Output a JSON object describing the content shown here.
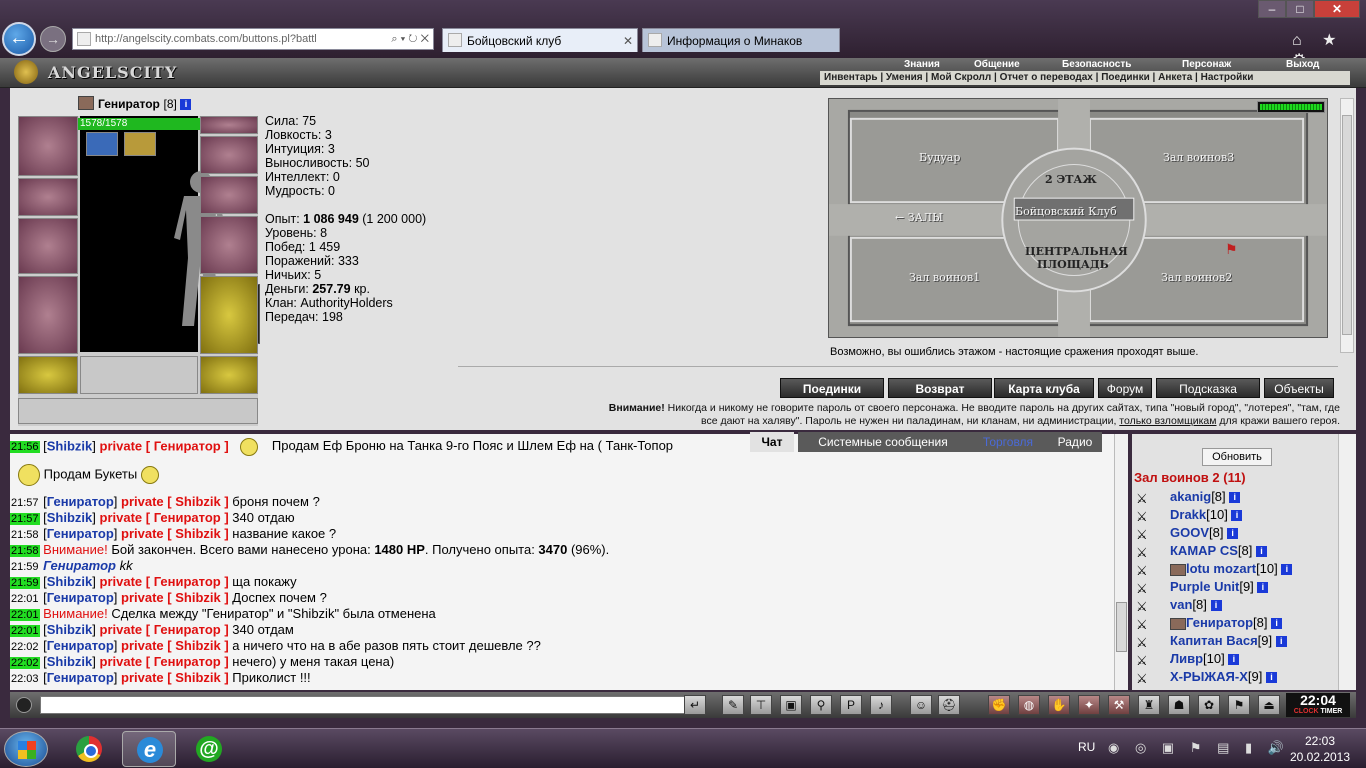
{
  "browser": {
    "address": "http://angelscity.combats.com/buttons.pl?battl",
    "tabs": [
      {
        "label": "Бойцовский клуб"
      },
      {
        "label": "Информация о Минаков"
      }
    ],
    "window_buttons": {
      "minimize": "–",
      "maximize": "□",
      "close": "✕"
    },
    "right_icons": "⌂ ★ ⚙"
  },
  "game": {
    "logo": "ANGELSCITY",
    "top_menu": [
      "Знания",
      "Общение",
      "Безопасность",
      "Персонаж",
      "Выход"
    ],
    "sub_menu": [
      "Инвентарь",
      "Умения",
      "Мой Скролл",
      "Отчет о переводах",
      "Поединки",
      "Анкета",
      "Настройки"
    ]
  },
  "character": {
    "name": "Гениратор",
    "level": "[8]",
    "hp": "1578/1578",
    "stats": [
      {
        "label": "Сила:",
        "value": "75"
      },
      {
        "label": "Ловкость:",
        "value": "3"
      },
      {
        "label": "Интуиция:",
        "value": "3"
      },
      {
        "label": "Выносливость:",
        "value": "50"
      },
      {
        "label": "Интеллект:",
        "value": "0"
      },
      {
        "label": "Мудрость:",
        "value": "0"
      }
    ],
    "exp_label": "Опыт:",
    "exp_value": "1 086 949",
    "exp_next": "(1 200 000)",
    "info": [
      {
        "label": "Уровень:",
        "value": "8"
      },
      {
        "label": "Побед:",
        "value": "1 459"
      },
      {
        "label": "Поражений:",
        "value": "333"
      },
      {
        "label": "Ничьих:",
        "value": "5"
      }
    ],
    "money_label": "Деньги:",
    "money_value": "257.79",
    "money_unit": "кр.",
    "clan_label": "Клан:",
    "clan_value": "AuthorityHolders",
    "transfers_label": "Передач:",
    "transfers_value": "198"
  },
  "map": {
    "labels": {
      "boudoir": "Будуар",
      "hall3": "Зал воинов3",
      "floor": "2 ЭТАЖ",
      "club": "Бойцовский Клуб",
      "halls": "← ЗАЛЫ",
      "central": "ЦЕНТРАЛЬНАЯ",
      "square": "ПЛОЩАДЬ",
      "hall1": "Зал воинов1",
      "hall2": "Зал воинов2"
    },
    "note": "Возможно, вы ошиблись этажом - настоящие сражения проходят выше."
  },
  "nav_buttons": [
    "Поединки",
    "Возврат",
    "Карта клуба",
    "Форум",
    "Подсказка",
    "Объекты"
  ],
  "warning": {
    "bold": "Внимание!",
    "text1": " Никогда и никому не говорите пароль от своего персонажа. Не вводите пароль на других сайтах, типа \"новый город\", \"лотерея\", \"там, где",
    "text2": "все дают на халяву\". Пароль не нужен ни паладинам, ни кланам, ни администрации, ",
    "link": "только взломщикам",
    "text3": " для кражи вашего героя."
  },
  "chat_tabs": [
    "Чат",
    "Системные сообщения",
    "Торговля",
    "Радио"
  ],
  "chat": [
    {
      "time": "21:56",
      "ts_green": true,
      "from": "Shibzik",
      "priv": "private [ Гениратор ]",
      "msg": "Продам Еф Броню на Танка 9-го Пояс и Шлем Еф на ( Танк-Топор"
    },
    {
      "time": "",
      "ts_green": false,
      "from": "",
      "priv": "",
      "msg": "Продам Букеты"
    },
    {
      "time": "21:57",
      "ts_green": false,
      "from": "Гениратор",
      "priv": "private [ Shibzik ]",
      "msg": "броня почем ?"
    },
    {
      "time": "21:57",
      "ts_green": true,
      "from": "Shibzik",
      "priv": "private [ Гениратор ]",
      "msg": "340 отдаю"
    },
    {
      "time": "21:58",
      "ts_green": false,
      "from": "Гениратор",
      "priv": "private [ Shibzik ]",
      "msg": "название какое ?"
    },
    {
      "time": "21:58",
      "ts_green": true,
      "from": "",
      "priv": "",
      "system": true,
      "warn": "Внимание!",
      "msg_pre": " Бой закончен. Всего вами нанесено урона: ",
      "dmg": "1480 HP",
      "msg_mid": ". Получено опыта: ",
      "exp": "3470",
      "msg_post": " (96%)."
    },
    {
      "time": "21:59",
      "ts_green": false,
      "from": "",
      "priv": "",
      "emote_nick": "Гениратор",
      "emote": "kk"
    },
    {
      "time": "21:59",
      "ts_green": true,
      "from": "Shibzik",
      "priv": "private [ Гениратор ]",
      "msg": "ща покажу"
    },
    {
      "time": "22:01",
      "ts_green": false,
      "from": "Гениратор",
      "priv": "private [ Shibzik ]",
      "msg": "Доспех почем ?"
    },
    {
      "time": "22:01",
      "ts_green": true,
      "from": "",
      "priv": "",
      "system2": true,
      "warn": "Внимание!",
      "msg": " Сделка между \"Гениратор\" и \"Shibzik\" была отменена"
    },
    {
      "time": "22:01",
      "ts_green": true,
      "from": "Shibzik",
      "priv": "private [ Гениратор ]",
      "msg": "340 отдам"
    },
    {
      "time": "22:02",
      "ts_green": false,
      "from": "Гениратор",
      "priv": "private [ Shibzik ]",
      "msg": "а ничего что на в абе разов пять стоит дешевле ??"
    },
    {
      "time": "22:02",
      "ts_green": true,
      "from": "Shibzik",
      "priv": "private [ Гениратор ]",
      "msg": "нечего) у меня такая цена)"
    },
    {
      "time": "22:03",
      "ts_green": false,
      "from": "Гениратор",
      "priv": "private [ Shibzik ]",
      "msg": "Приколист !!!"
    }
  ],
  "userlist": {
    "refresh": "Обновить",
    "room": "Зал воинов 2 (11)",
    "users": [
      {
        "name": "akanig",
        "level": "[8]",
        "clan": false
      },
      {
        "name": "Drakk",
        "level": "[10]",
        "clan": false
      },
      {
        "name": "GOOV",
        "level": "[8]",
        "clan": false
      },
      {
        "name": "КАМАР CS",
        "level": "[8]",
        "clan": false
      },
      {
        "name": "lotu mozart",
        "level": "[10]",
        "clan": true
      },
      {
        "name": "Purple Unit",
        "level": "[9]",
        "clan": false
      },
      {
        "name": "van",
        "level": "[8]",
        "clan": false
      },
      {
        "name": "Гениратор",
        "level": "[8]",
        "clan": true
      },
      {
        "name": "Капитан Вася",
        "level": "[9]",
        "clan": false
      },
      {
        "name": "Ливр",
        "level": "[10]",
        "clan": false
      },
      {
        "name": "Х-РЫЖАЯ-Х",
        "level": "[9]",
        "clan": false
      }
    ]
  },
  "clock": {
    "time": "22:04",
    "clock_label": "CLOCK",
    "timer_label": "TIMER"
  },
  "taskbar": {
    "lang": "RU",
    "time": "22:03",
    "date": "20.02.2013"
  }
}
